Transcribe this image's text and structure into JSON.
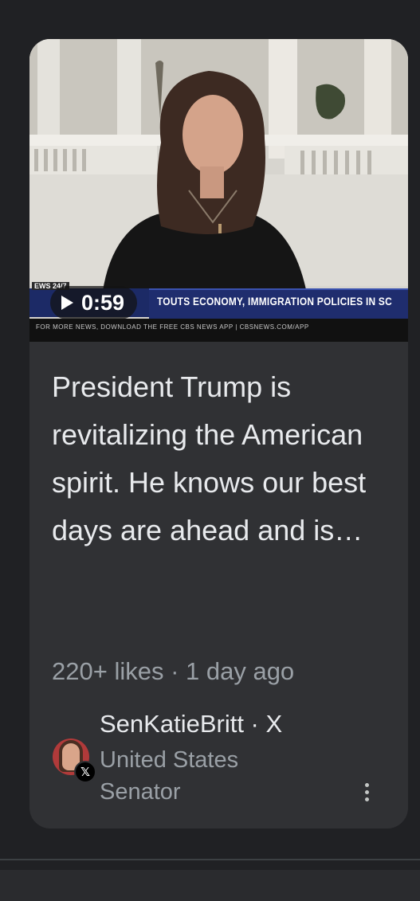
{
  "video": {
    "duration": "0:59",
    "ticker_headline": "TOUTS ECONOMY, IMMIGRATION POLICIES IN SC",
    "ticker_network": "EWS 24/7",
    "ticker_footer": "FOR MORE NEWS, DOWNLOAD THE FREE CBS NEWS APP | CBSNEWS.COM/APP"
  },
  "post": {
    "headline": "President Trump is revitalizing the American spirit. He knows our best days are ahead and is…",
    "meta": "220+ likes · 1 day ago",
    "source_name": "SenKatieBritt · X",
    "source_subtitle": "United States Senator",
    "badge_icon": "x-logo-icon"
  },
  "colors": {
    "background": "#202124",
    "card": "#303134",
    "text_primary": "#e8eaed",
    "text_secondary": "#9aa0a6"
  }
}
